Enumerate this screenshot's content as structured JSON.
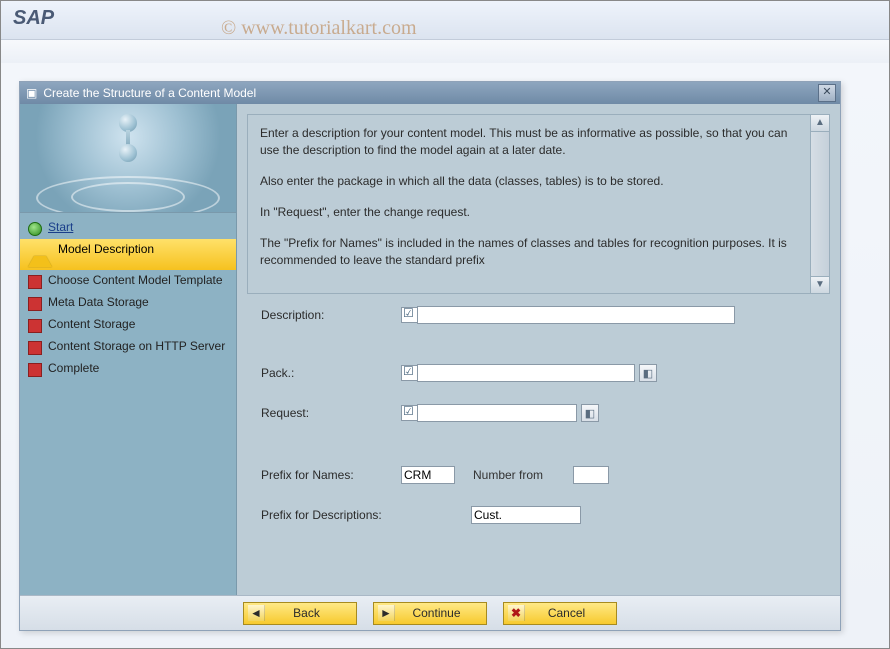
{
  "app": {
    "title": "SAP"
  },
  "watermark": "© www.tutorialkart.com",
  "dialog": {
    "title": "Create the Structure of a Content Model"
  },
  "wizard": {
    "steps": [
      {
        "label": "Start",
        "link": true
      },
      {
        "label": "Model Description"
      },
      {
        "label": "Choose Content Model Template"
      },
      {
        "label": "Meta Data Storage"
      },
      {
        "label": "Content Storage"
      },
      {
        "label": "Content Storage on HTTP Server"
      },
      {
        "label": "Complete"
      }
    ]
  },
  "instructions": {
    "p1": "Enter a description for your content model. This must be as informative as possible, so that you can use the description to find the model again at a later date.",
    "p2": "Also enter the package in which all the data (classes, tables) is to be stored.",
    "p3": "In \"Request\", enter the change request.",
    "p4": "The \"Prefix for Names\" is included in the names of classes and tables for recognition purposes. It is recommended to leave the standard prefix"
  },
  "form": {
    "description_label": "Description:",
    "description_value": "",
    "pack_label": "Pack.:",
    "pack_value": "",
    "request_label": "Request:",
    "request_value": "",
    "prefix_names_label": "Prefix for Names:",
    "prefix_names_value": "CRM",
    "number_from_label": "Number from",
    "number_from_value": "",
    "prefix_desc_label": "Prefix for Descriptions:",
    "prefix_desc_value": "Cust."
  },
  "buttons": {
    "back": "Back",
    "continue": "Continue",
    "cancel": "Cancel"
  }
}
